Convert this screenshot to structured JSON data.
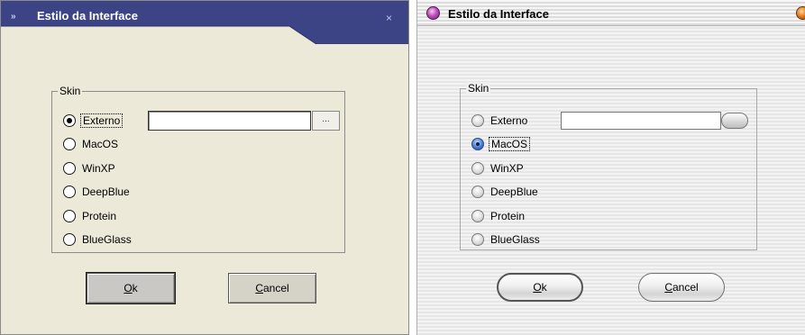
{
  "left_dialog": {
    "title": "Estilo da Interface",
    "title_icon_glyph": "»",
    "close_glyph": "×",
    "skin": {
      "legend": "Skin",
      "browse_label": "...",
      "external_value": "",
      "options": [
        {
          "label": "Externo",
          "checked": true
        },
        {
          "label": "MacOS",
          "checked": false
        },
        {
          "label": "WinXP",
          "checked": false
        },
        {
          "label": "DeepBlue",
          "checked": false
        },
        {
          "label": "Protein",
          "checked": false
        },
        {
          "label": "BlueGlass",
          "checked": false
        }
      ]
    },
    "buttons": {
      "ok_mnemonic": "O",
      "ok_rest": "k",
      "cancel_mnemonic": "C",
      "cancel_rest": "ancel"
    }
  },
  "right_dialog": {
    "title": "Estilo da Interface",
    "skin": {
      "legend": "Skin",
      "external_value": "",
      "options": [
        {
          "label": "Externo",
          "checked": false
        },
        {
          "label": "MacOS",
          "checked": true
        },
        {
          "label": "WinXP",
          "checked": false
        },
        {
          "label": "DeepBlue",
          "checked": false
        },
        {
          "label": "Protein",
          "checked": false
        },
        {
          "label": "BlueGlass",
          "checked": false
        }
      ]
    },
    "buttons": {
      "ok_mnemonic": "O",
      "ok_rest": "k",
      "cancel_mnemonic": "C",
      "cancel_rest": "ancel"
    }
  },
  "colors": {
    "left_titlebar": "#3d4486",
    "left_face": "#ece9d8",
    "right_selected_radio": "#4a7ccf",
    "right_title_ball": "#c050c0",
    "right_close_ball": "#e07a20"
  }
}
